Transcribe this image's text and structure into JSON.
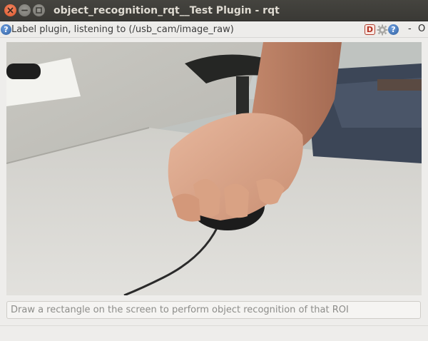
{
  "window": {
    "title": "object_recognition_rqt__Test Plugin - rqt",
    "close_symbol": "×",
    "minimize_symbol": "−",
    "maximize_symbol": "□"
  },
  "plugin": {
    "help_symbol": "?",
    "label": "Label plugin, listening to (/usb_cam/image_raw)",
    "debug_symbol": "D",
    "help_symbol_right": "?",
    "minimize_symbol": "-",
    "close_symbol": "O"
  },
  "camera": {
    "subject": "camera feed: hand on computer mouse on desk"
  },
  "roi_input": {
    "placeholder": "Draw a rectangle on the screen to perform object recognition of that ROI",
    "value": ""
  },
  "colors": {
    "titlebar": "#3c3b37",
    "title_text": "#dfdbd2",
    "close_button": "#e5582f",
    "window_background": "#eeedeb"
  },
  "icons": [
    "close-icon",
    "minimize-icon",
    "maximize-icon",
    "help-icon",
    "debug-icon",
    "gear-icon"
  ]
}
